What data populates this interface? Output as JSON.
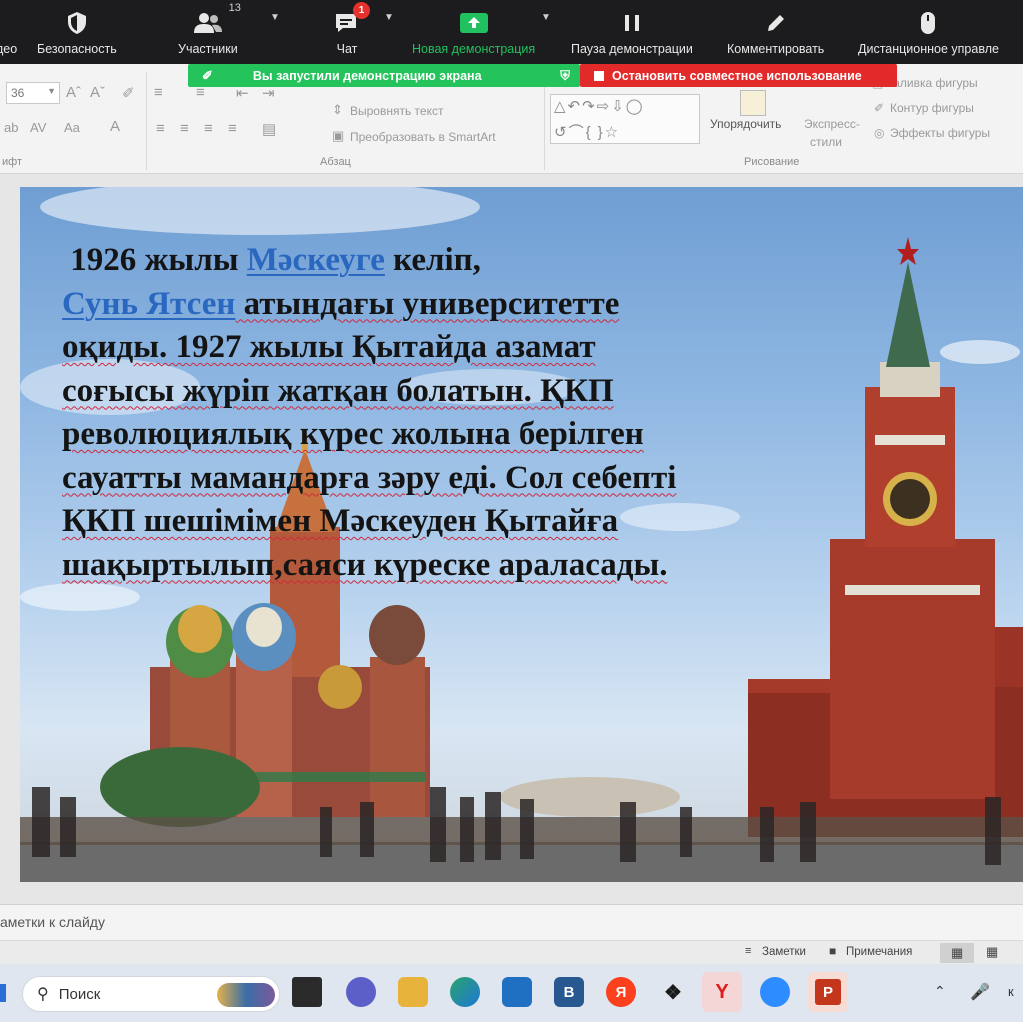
{
  "zoom_toolbar": {
    "video_label": "део",
    "security_label": "Безопасность",
    "participants_label": "Участники",
    "participants_count": "13",
    "chat_label": "Чат",
    "chat_badge": "1",
    "new_share_label": "Новая демонстрация",
    "pause_share_label": "Пауза демонстрации",
    "annotate_label": "Комментировать",
    "remote_control_label": "Дистанционное управле"
  },
  "share_banner": {
    "status_text": "Вы запустили демонстрацию экрана",
    "stop_text": "Остановить совместное использование"
  },
  "ribbon": {
    "font_size_value": "36",
    "font_group_label": "ифт",
    "paragraph_group_label": "Абзац",
    "align_text_label": "Выровнять текст",
    "smartart_label": "Преобразовать в SmartArt",
    "arrange_label": "Упорядочить",
    "express_styles_label_1": "Экспресс-",
    "express_styles_label_2": "стили",
    "shape_fill_label": "Заливка фигуры",
    "shape_outline_label": "Контур фигуры",
    "shape_effects_label": "Эффекты фигуры",
    "drawing_group_label": "Рисование"
  },
  "slide": {
    "text_lines": {
      "l1_a": "1926 жылы ",
      "l1_link": "Мәскеуге",
      "l1_b": " келіп,",
      "l2_link": "Сунь Ятсен",
      "l2_b": " атындағы университетте",
      "l3": "оқиды. 1927 жылы Қытайда  азамат",
      "l4": "соғысы жүріп жатқан болатын. ҚКП",
      "l5": "революциялық күрес жолына берілген",
      "l6": "сауатты мамандарға зәру еді. Сол себепті",
      "l7": "ҚКП шешімімен Мәскеуден Қытайға",
      "l8": "шақыртылып,саяси күреске араласады."
    }
  },
  "notes": {
    "placeholder": "аметки к слайду"
  },
  "status_bar": {
    "notes_label": "Заметки",
    "comments_label": "Примечания"
  },
  "taskbar": {
    "search_placeholder": "Поиск",
    "app_b_letter": "B",
    "app_ya_letter": "Я",
    "app_y_letter": "Y",
    "app_p_letter": "P",
    "lang_label": "к"
  }
}
